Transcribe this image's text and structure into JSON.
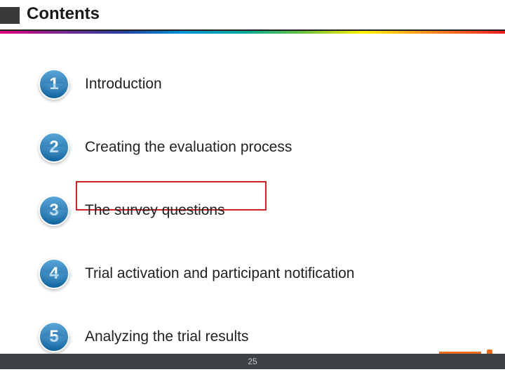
{
  "header": {
    "title": "Contents"
  },
  "items": [
    {
      "num": "1",
      "label": "Introduction"
    },
    {
      "num": "2",
      "label": "Creating the evaluation process"
    },
    {
      "num": "3",
      "label": "The survey questions"
    },
    {
      "num": "4",
      "label": "Trial activation and participant notification"
    },
    {
      "num": "5",
      "label": "Analyzing the trial results"
    }
  ],
  "highlighted_index": 2,
  "footer": {
    "page_number": "25"
  }
}
